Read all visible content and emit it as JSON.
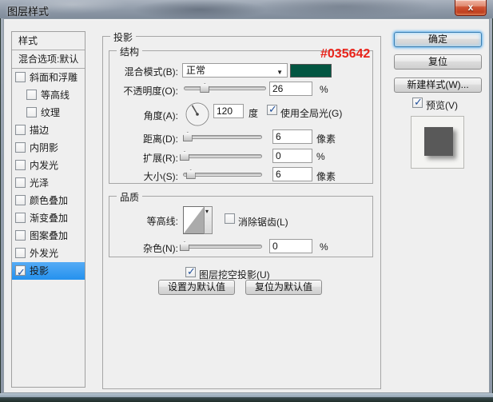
{
  "window": {
    "title": "图层样式"
  },
  "sidebar": {
    "header": "样式",
    "blend_options": "混合选项:默认",
    "items": [
      {
        "label": "斜面和浮雕",
        "checked": false,
        "indent": false,
        "selected": false
      },
      {
        "label": "等高线",
        "checked": false,
        "indent": true,
        "selected": false
      },
      {
        "label": "纹理",
        "checked": false,
        "indent": true,
        "selected": false
      },
      {
        "label": "描边",
        "checked": false,
        "indent": false,
        "selected": false
      },
      {
        "label": "内阴影",
        "checked": false,
        "indent": false,
        "selected": false
      },
      {
        "label": "内发光",
        "checked": false,
        "indent": false,
        "selected": false
      },
      {
        "label": "光泽",
        "checked": false,
        "indent": false,
        "selected": false
      },
      {
        "label": "颜色叠加",
        "checked": false,
        "indent": false,
        "selected": false
      },
      {
        "label": "渐变叠加",
        "checked": false,
        "indent": false,
        "selected": false
      },
      {
        "label": "图案叠加",
        "checked": false,
        "indent": false,
        "selected": false
      },
      {
        "label": "外发光",
        "checked": false,
        "indent": false,
        "selected": false
      },
      {
        "label": "投影",
        "checked": true,
        "indent": false,
        "selected": true
      }
    ]
  },
  "panel": {
    "title": "投影",
    "structure": {
      "legend": "结构",
      "blend_mode": {
        "label": "混合模式(B):",
        "value": "正常",
        "swatch_color": "#035642"
      },
      "color_annotation": {
        "text": "#035642",
        "color": "#e8231a"
      },
      "opacity": {
        "label": "不透明度(O):",
        "value": "26",
        "unit": "%",
        "thumb_pct": 25
      },
      "angle": {
        "label": "角度(A):",
        "value": "120",
        "unit": "度",
        "global_light": {
          "label": "使用全局光(G)",
          "checked": true
        }
      },
      "distance": {
        "label": "距离(D):",
        "value": "6",
        "unit": "像素",
        "thumb_pct": 5
      },
      "spread": {
        "label": "扩展(R):",
        "value": "0",
        "unit": "%",
        "thumb_pct": 1
      },
      "size": {
        "label": "大小(S):",
        "value": "6",
        "unit": "像素",
        "thumb_pct": 9
      }
    },
    "quality": {
      "legend": "品质",
      "contour_label": "等高线:",
      "anti_alias": {
        "label": "消除锯齿(L)",
        "checked": false
      },
      "noise": {
        "label": "杂色(N):",
        "value": "0",
        "unit": "%",
        "thumb_pct": 1
      }
    },
    "knockout": {
      "label": "图层挖空投影(U)",
      "checked": true
    },
    "default_buttons": {
      "make_default": "设置为默认值",
      "reset_default": "复位为默认值"
    }
  },
  "actions": {
    "ok": "确定",
    "reset": "复位",
    "new_style": "新建样式(W)...",
    "preview": {
      "label": "预览(V)",
      "checked": true
    }
  }
}
